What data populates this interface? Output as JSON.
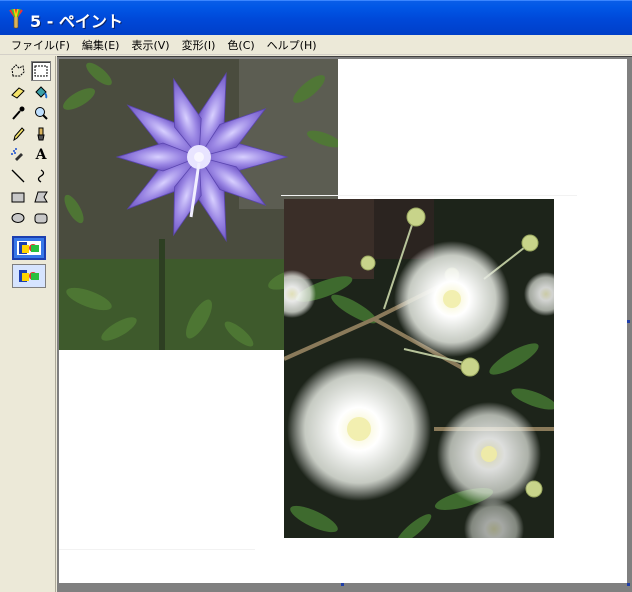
{
  "window": {
    "title": "5 - ペイント",
    "accent": "#0054e3"
  },
  "menu": [
    {
      "label": "ファイル(F)"
    },
    {
      "label": "編集(E)"
    },
    {
      "label": "表示(V)"
    },
    {
      "label": "変形(I)"
    },
    {
      "label": "色(C)"
    },
    {
      "label": "ヘルプ(H)"
    }
  ],
  "tools": [
    {
      "name": "free-form-select-icon",
      "selected": false
    },
    {
      "name": "rectangle-select-icon",
      "selected": true
    },
    {
      "name": "eraser-icon",
      "selected": false
    },
    {
      "name": "fill-bucket-icon",
      "selected": false
    },
    {
      "name": "pick-color-icon",
      "selected": false
    },
    {
      "name": "magnifier-icon",
      "selected": false
    },
    {
      "name": "pencil-icon",
      "selected": false
    },
    {
      "name": "brush-icon",
      "selected": false
    },
    {
      "name": "airbrush-icon",
      "selected": false
    },
    {
      "name": "text-icon",
      "selected": false,
      "glyph": "A"
    },
    {
      "name": "line-icon",
      "selected": false
    },
    {
      "name": "curve-icon",
      "selected": false
    },
    {
      "name": "rectangle-icon",
      "selected": false
    },
    {
      "name": "polygon-icon",
      "selected": false
    },
    {
      "name": "ellipse-icon",
      "selected": false
    },
    {
      "name": "rounded-rectangle-icon",
      "selected": false
    }
  ],
  "canvas_images": [
    {
      "name": "purple-balloon-flower-photo"
    },
    {
      "name": "white-puffball-flower-photo"
    }
  ]
}
